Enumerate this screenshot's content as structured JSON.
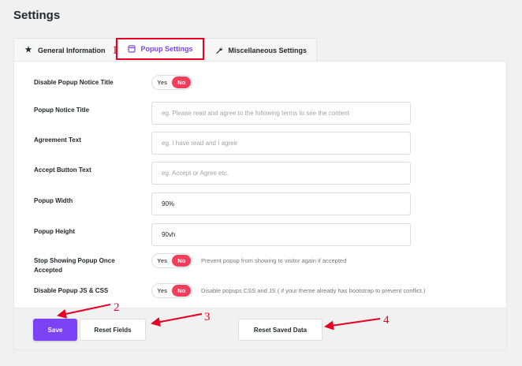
{
  "page": {
    "title": "Settings"
  },
  "tabs": [
    {
      "label": "General Information",
      "icon": "star-icon",
      "active": false
    },
    {
      "label": "Popup Settings",
      "icon": "window-icon",
      "active": true
    },
    {
      "label": "Miscellaneous Settings",
      "icon": "wrench-icon",
      "active": false
    }
  ],
  "fields": {
    "disable_notice_title": {
      "label": "Disable Popup Notice Title",
      "yes": "Yes",
      "no": "No"
    },
    "notice_title": {
      "label": "Popup Notice Title",
      "placeholder": "eg. Please read and agree to the following terms to see the content"
    },
    "agreement_text": {
      "label": "Agreement Text",
      "placeholder": "eg. I have read and I agree"
    },
    "accept_button_text": {
      "label": "Accept Button Text",
      "placeholder": "eg. Accept or Agree etc."
    },
    "popup_width": {
      "label": "Popup Width",
      "value": "90%"
    },
    "popup_height": {
      "label": "Popup Height",
      "value": "90vh"
    },
    "stop_showing": {
      "label": "Stop Showing Popup Once Accepted",
      "yes": "Yes",
      "no": "No",
      "hint": "Prevent popup from showing to visitor again if accepted"
    },
    "disable_js_css": {
      "label": "Disable Popup JS & CSS",
      "yes": "Yes",
      "no": "No",
      "hint": "Disable popups CSS and JS ( if your theme already has bootstrap to prevent conflict.)"
    }
  },
  "footer": {
    "save": "Save",
    "reset_fields": "Reset Fields",
    "reset_saved": "Reset Saved Data"
  },
  "annotations": {
    "n1": "1",
    "n2": "2",
    "n3": "3",
    "n4": "4"
  },
  "colors": {
    "accent": "#7b42f6",
    "toggle_no": "#f23d5b",
    "annotation": "#e60023"
  }
}
